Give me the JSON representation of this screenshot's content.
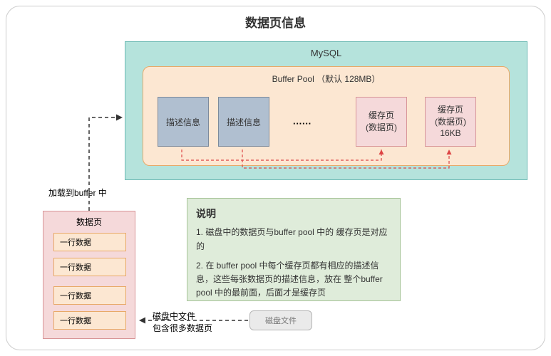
{
  "title": "数据页信息",
  "mysql": {
    "label": "MySQL",
    "buffer_pool": {
      "label": "Buffer Pool  （默认 128MB）",
      "desc1": "描述信息",
      "desc2": "描述信息",
      "dots": "······",
      "cache1": "缓存页\n(数据页)",
      "cache2": "缓存页\n(数据页)\n16KB"
    }
  },
  "load_label": "加载到buffer 中",
  "data_page": {
    "label": "数据页",
    "rows": [
      "一行数据",
      "一行数据",
      "一行数据",
      "一行数据"
    ]
  },
  "explain": {
    "title": "说明",
    "line1": "1. 磁盘中的数据页与buffer pool 中的 缓存页是对应的",
    "line2": "2. 在 buffer pool 中每个缓存页都有相应的描述信息，这些每张数据页的描述信息，放在 整个buffer pool 中的最前面，后面才是缓存页"
  },
  "disk": {
    "label": "磁盘中文件\n包含很多数据页",
    "file": "磁盘文件"
  }
}
